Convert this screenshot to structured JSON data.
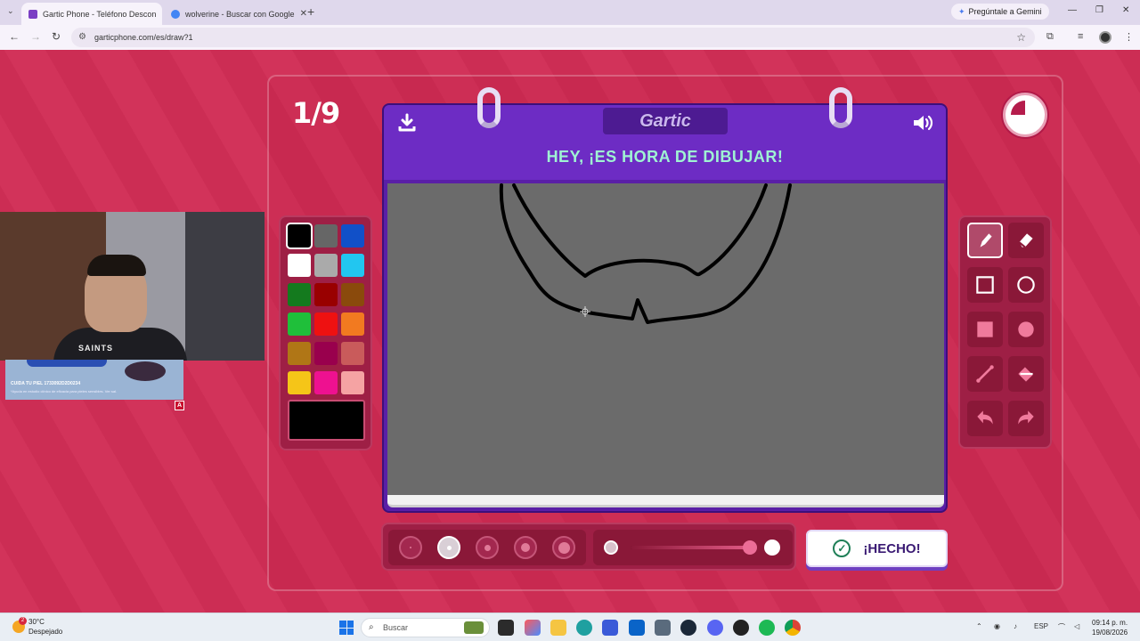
{
  "browser": {
    "tabs": [
      {
        "title": "Gartic Phone - Teléfono Descon",
        "active": true,
        "favicon_color": "#7b3fc4"
      },
      {
        "title": "wolverine - Buscar con Google",
        "active": false,
        "favicon_color": "#4285f4"
      }
    ],
    "new_tab": "+",
    "gemini_label": "Pregúntale a Gemini",
    "url": "garticphone.com/es/draw?1"
  },
  "game": {
    "round": "1/9",
    "logo": "Gartic",
    "headline": "HEY, ¡ES HORA DE DIBUJAR!",
    "done_label": "¡HECHO!",
    "timer_remaining_fraction": 0.75,
    "palette": [
      {
        "color": "#000000",
        "selected": true
      },
      {
        "color": "#666666"
      },
      {
        "color": "#1150c8"
      },
      {
        "color": "#ffffff"
      },
      {
        "color": "#aaaaaa"
      },
      {
        "color": "#22c6f0"
      },
      {
        "color": "#147a1e"
      },
      {
        "color": "#990000"
      },
      {
        "color": "#8a4a0c"
      },
      {
        "color": "#1fbf3a"
      },
      {
        "color": "#ee1111"
      },
      {
        "color": "#f27a20"
      },
      {
        "color": "#b07616"
      },
      {
        "color": "#99004d"
      },
      {
        "color": "#c95b5b"
      },
      {
        "color": "#f5c518"
      },
      {
        "color": "#ee1190"
      },
      {
        "color": "#f5a3a3"
      }
    ],
    "current_color": "#000000",
    "tools": [
      {
        "icon": "pencil-icon",
        "selected": true
      },
      {
        "icon": "eraser-icon"
      },
      {
        "icon": "square-outline-icon"
      },
      {
        "icon": "circle-outline-icon"
      },
      {
        "icon": "square-filled-icon"
      },
      {
        "icon": "circle-filled-icon"
      },
      {
        "icon": "line-icon"
      },
      {
        "icon": "fill-bucket-icon"
      },
      {
        "icon": "undo-icon"
      },
      {
        "icon": "redo-icon"
      }
    ],
    "brush_sizes_selected_index": 1,
    "opacity_level": 1.0
  },
  "webcam": {
    "shirt_text": "SAINTS",
    "ad_line1": "CUIDA TU PIEL 1733092D2D0234",
    "ad_line2": "*Ayuda en estudio clínico de eficacia para pieles sensibles. Ver sal.",
    "ad_badge": "A"
  },
  "taskbar": {
    "temp": "30°C",
    "weather": "Despejado",
    "weather_badge": "2",
    "search_placeholder": "Buscar",
    "lang": "ESP",
    "time": "09:14 p. m.",
    "date": "19/08/2026"
  }
}
